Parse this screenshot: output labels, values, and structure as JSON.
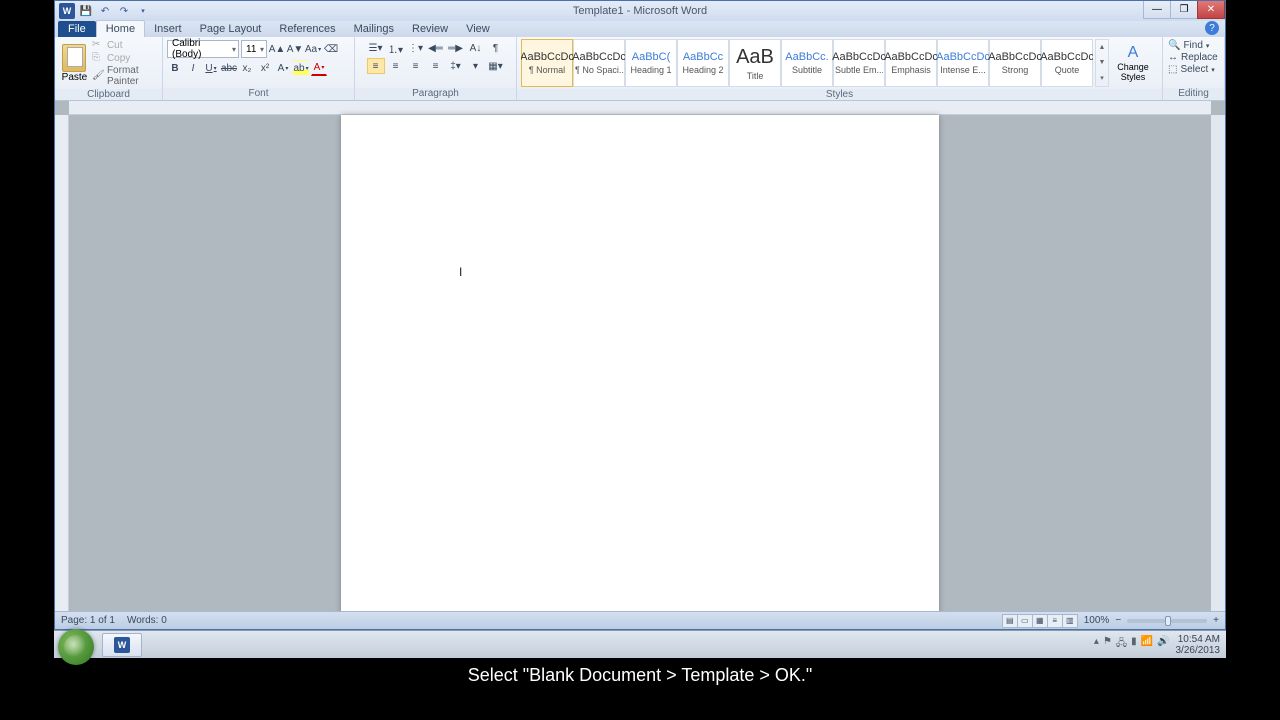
{
  "window": {
    "title": "Template1 - Microsoft Word",
    "min": "—",
    "max": "❐",
    "close": "✕"
  },
  "tabs": {
    "file": "File",
    "home": "Home",
    "insert": "Insert",
    "page_layout": "Page Layout",
    "references": "References",
    "mailings": "Mailings",
    "review": "Review",
    "view": "View"
  },
  "clipboard": {
    "paste": "Paste",
    "cut": "Cut",
    "copy": "Copy",
    "format_painter": "Format Painter",
    "group": "Clipboard"
  },
  "font": {
    "name": "Calibri (Body)",
    "size": "11",
    "group": "Font"
  },
  "paragraph": {
    "group": "Paragraph"
  },
  "styles": {
    "items": [
      {
        "preview": "AaBbCcDc",
        "label": "¶ Normal",
        "sel": true,
        "cls": ""
      },
      {
        "preview": "AaBbCcDc",
        "label": "¶ No Spaci...",
        "sel": false,
        "cls": ""
      },
      {
        "preview": "AaBbC(",
        "label": "Heading 1",
        "sel": false,
        "cls": "blue"
      },
      {
        "preview": "AaBbCc",
        "label": "Heading 2",
        "sel": false,
        "cls": "blue"
      },
      {
        "preview": "AaB",
        "label": "Title",
        "sel": false,
        "cls": "big"
      },
      {
        "preview": "AaBbCc.",
        "label": "Subtitle",
        "sel": false,
        "cls": "blue"
      },
      {
        "preview": "AaBbCcDc",
        "label": "Subtle Em...",
        "sel": false,
        "cls": ""
      },
      {
        "preview": "AaBbCcDc",
        "label": "Emphasis",
        "sel": false,
        "cls": ""
      },
      {
        "preview": "AaBbCcDc",
        "label": "Intense E...",
        "sel": false,
        "cls": "blue"
      },
      {
        "preview": "AaBbCcDc",
        "label": "Strong",
        "sel": false,
        "cls": ""
      },
      {
        "preview": "AaBbCcDc",
        "label": "Quote",
        "sel": false,
        "cls": ""
      }
    ],
    "change": "Change Styles",
    "group": "Styles"
  },
  "editing": {
    "find": "Find",
    "replace": "Replace",
    "select": "Select",
    "group": "Editing"
  },
  "status": {
    "page": "Page: 1 of 1",
    "words": "Words: 0",
    "zoom": "100%"
  },
  "tray": {
    "time": "10:54 AM",
    "date": "3/26/2013"
  },
  "caption": "Select \"Blank Document > Template > OK.\""
}
